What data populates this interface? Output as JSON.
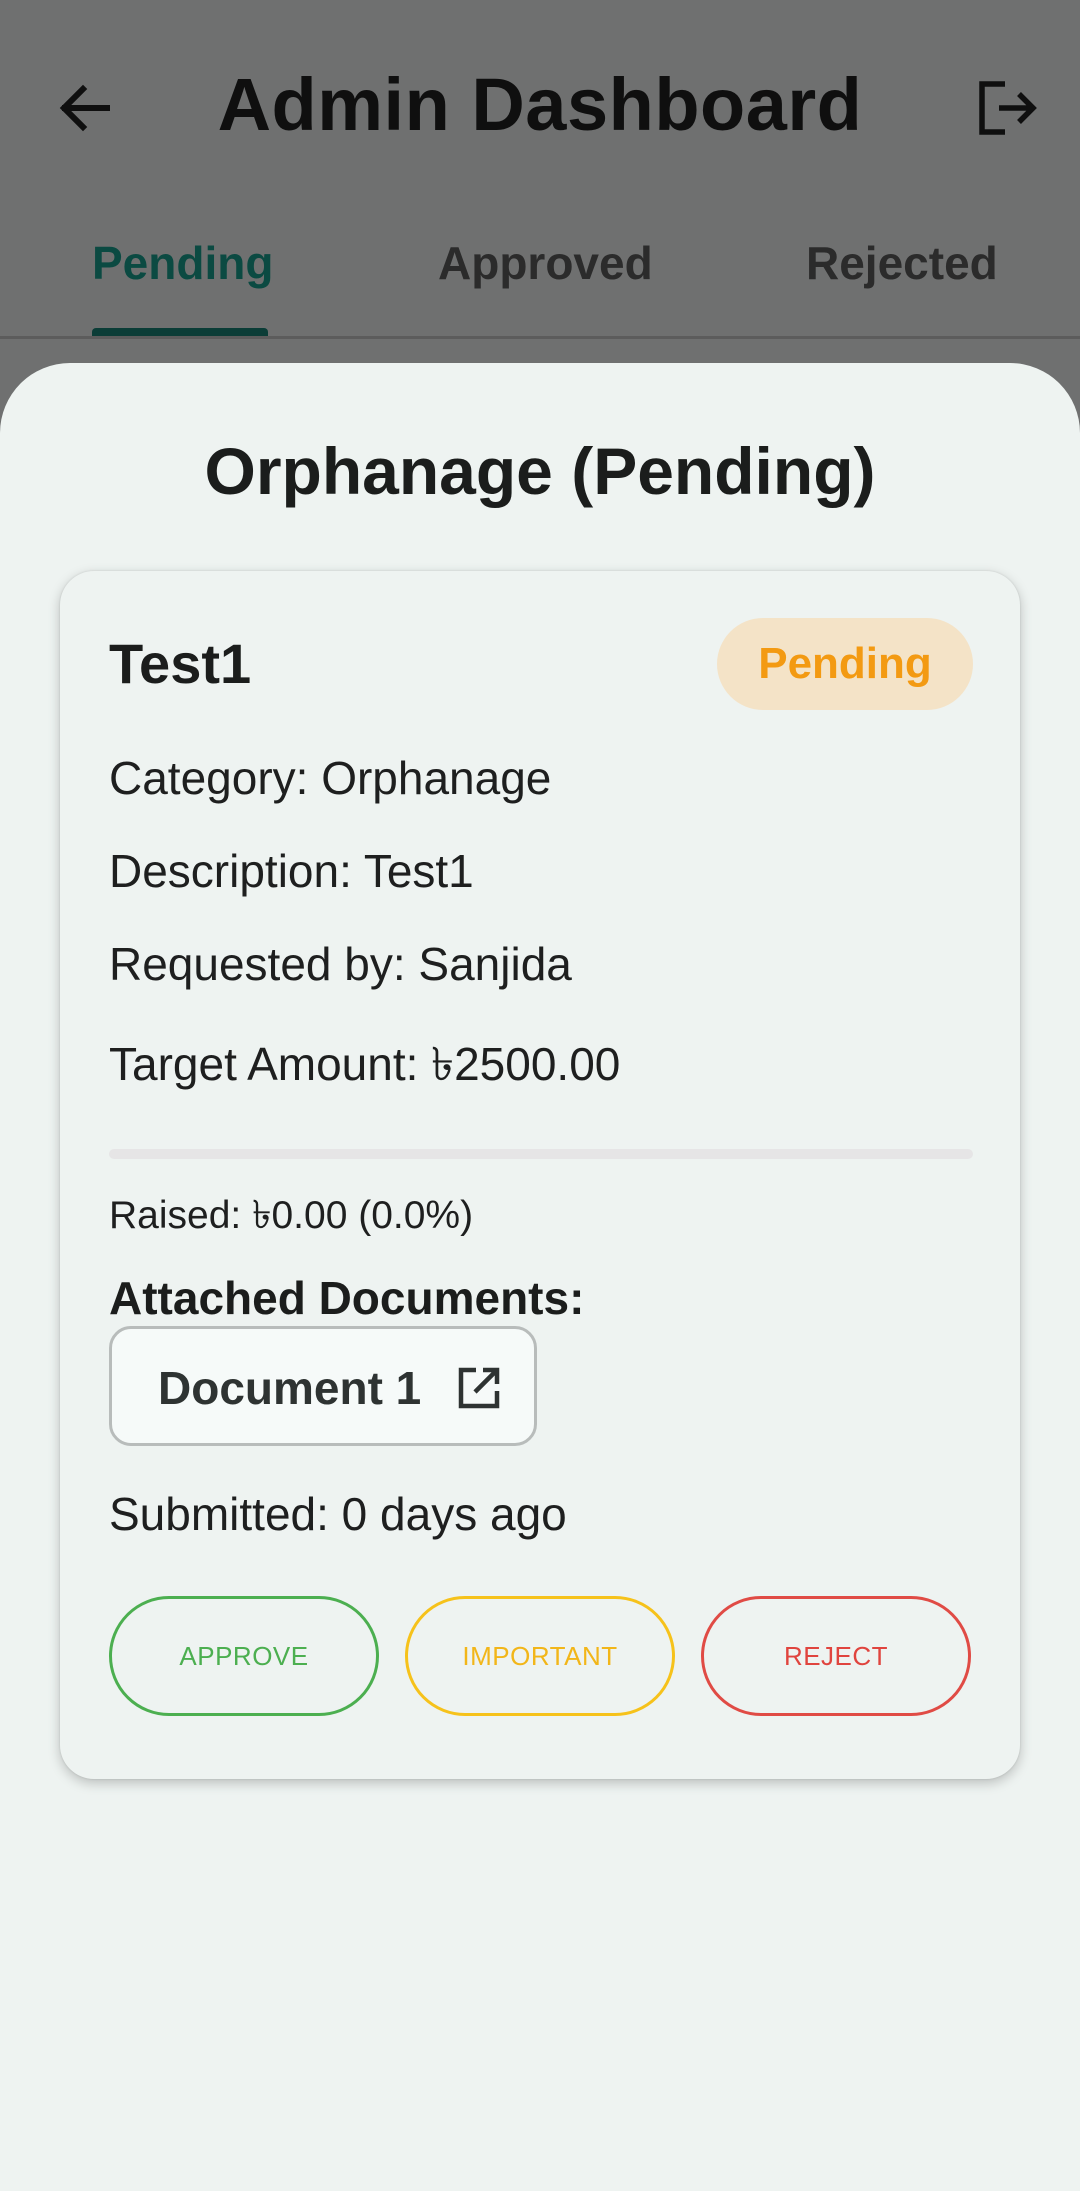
{
  "app_bar": {
    "title": "Admin Dashboard",
    "back_icon": "arrow-left-icon",
    "logout_icon": "logout-icon"
  },
  "tabs": [
    {
      "label": "Pending",
      "active": true
    },
    {
      "label": "Approved",
      "active": false
    },
    {
      "label": "Rejected",
      "active": false
    }
  ],
  "sheet": {
    "title": "Orphanage (Pending)"
  },
  "request": {
    "title": "Test1",
    "status": "Pending",
    "category": "Category: Orphanage",
    "description": "Description: Test1",
    "requested_by": "Requested by: Sanjida",
    "target_amount": "Target Amount: ৳2500.00",
    "progress_fraction": 0.0,
    "raised": "Raised: ৳0.00 (0.0%)",
    "documents_heading": "Attached Documents:",
    "documents": [
      {
        "label": "Document 1",
        "icon": "open-in-new-icon"
      }
    ],
    "submitted": "Submitted: 0 days ago"
  },
  "actions": {
    "approve": "APPROVE",
    "important": "IMPORTANT",
    "reject": "REJECT"
  },
  "colors": {
    "accent": "#0b4a42",
    "status_pending_bg": "#f4e3c7",
    "status_pending_text": "#f39a12",
    "approve": "#4caf50",
    "important": "#f6c21b",
    "reject": "#e04b45"
  }
}
